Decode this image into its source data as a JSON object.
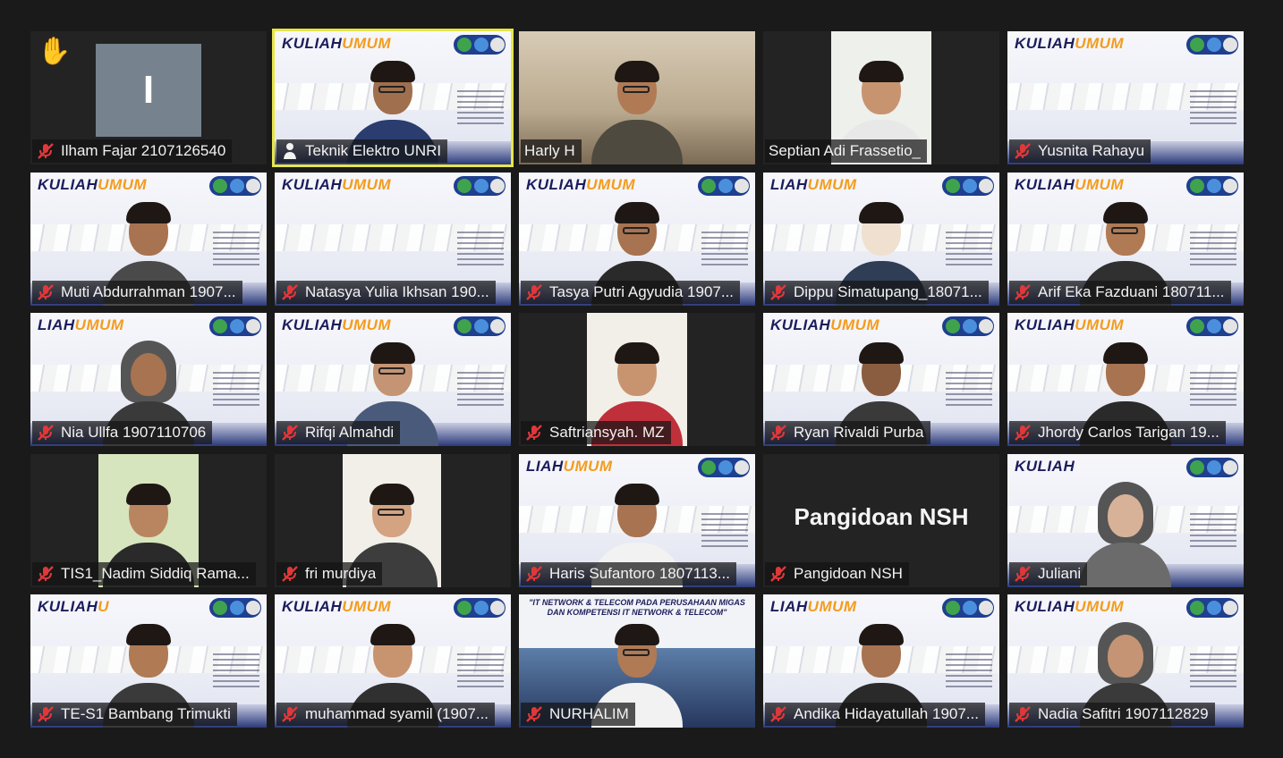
{
  "meeting": {
    "participants": [
      {
        "name": "Ilham Fajar 2107126540",
        "muted": true,
        "view": "initial",
        "initial": "I",
        "raised_hand": true
      },
      {
        "name": "Teknik Elektro UNRI",
        "muted": false,
        "view": "slide",
        "active_speaker": true,
        "slide_title": "KULIAH UMUM",
        "slide_title_accent": "UMUM",
        "slide_title_main": "KULIAH"
      },
      {
        "name": "Harly H",
        "muted": false,
        "view": "camera"
      },
      {
        "name": "Septian Adi Frassetio_",
        "muted": false,
        "view": "camera"
      },
      {
        "name": "Yusnita Rahayu",
        "muted": true,
        "view": "slide",
        "slide_title_main": "KULIAH",
        "slide_title_accent": "UMUM"
      },
      {
        "name": "Muti Abdurrahman 1907...",
        "muted": true,
        "view": "slide",
        "slide_title_main": "KULIAH",
        "slide_title_accent": "UMUM"
      },
      {
        "name": "Natasya Yulia Ikhsan 190...",
        "muted": true,
        "view": "slide",
        "slide_title_main": "KULIAH",
        "slide_title_accent": "UMUM"
      },
      {
        "name": "Tasya Putri Agyudia 1907...",
        "muted": true,
        "view": "slide",
        "slide_title_main": "KULIAH",
        "slide_title_accent": "UMUM"
      },
      {
        "name": "Dippu Simatupang_18071...",
        "muted": true,
        "view": "slide",
        "slide_title_main": "LIAH",
        "slide_title_accent": "UMUM"
      },
      {
        "name": "Arif Eka Fazduani 180711...",
        "muted": true,
        "view": "slide",
        "slide_title_main": "KULIAH",
        "slide_title_accent": "UMUM"
      },
      {
        "name": "Nia Ullfa 1907110706",
        "muted": true,
        "view": "slide",
        "slide_title_main": "LIAH",
        "slide_title_accent": "UMUM"
      },
      {
        "name": "Rifqi Almahdi",
        "muted": true,
        "view": "slide",
        "slide_title_main": "KULIAH",
        "slide_title_accent": "UMUM"
      },
      {
        "name": "Saftriansyah. MZ",
        "muted": true,
        "view": "camera"
      },
      {
        "name": "Ryan Rivaldi Purba",
        "muted": true,
        "view": "slide",
        "slide_title_main": "KULIAH",
        "slide_title_accent": "UMUM"
      },
      {
        "name": "Jhordy Carlos Tarigan 19...",
        "muted": true,
        "view": "slide",
        "slide_title_main": "KULIAH",
        "slide_title_accent": "UMUM"
      },
      {
        "name": "TIS1_Nadim Siddiq Rama...",
        "muted": true,
        "view": "camera"
      },
      {
        "name": "fri murdiya",
        "muted": true,
        "view": "camera"
      },
      {
        "name": "Haris Sufantoro 1807113...",
        "muted": true,
        "view": "slide",
        "slide_title_main": "LIAH",
        "slide_title_accent": "UMUM"
      },
      {
        "name": "Pangidoan NSH",
        "muted": true,
        "view": "name",
        "display_name": "Pangidoan NSH"
      },
      {
        "name": "Juliani",
        "muted": true,
        "view": "slide",
        "slide_title_main": "KULIAH",
        "slide_title_accent": ""
      },
      {
        "name": "TE-S1 Bambang Trimukti",
        "muted": true,
        "view": "slide",
        "slide_title_main": "KULIAH",
        "slide_title_accent": "U"
      },
      {
        "name": "muhammad syamil (1907...",
        "muted": true,
        "view": "slide",
        "slide_title_main": "KULIAH",
        "slide_title_accent": "UMUM"
      },
      {
        "name": "NURHALIM",
        "muted": true,
        "view": "banner",
        "banner_text": "\"IT NETWORK & TELECOM PADA PERUSAHAAN MIGAS DAN KOMPETENSI IT NETWORK & TELECOM\""
      },
      {
        "name": "Andika Hidayatullah 1907...",
        "muted": true,
        "view": "slide",
        "slide_title_main": "LIAH",
        "slide_title_accent": "UMUM"
      },
      {
        "name": "Nadia Safitri 1907112829",
        "muted": true,
        "view": "slide",
        "slide_title_main": "KULIAH",
        "slide_title_accent": "UMUM"
      }
    ]
  },
  "colors": {
    "background": "#1a1a1a",
    "tile": "#232323",
    "active_border": "#e6e64a",
    "muted_icon": "#e0383a",
    "slide_navy": "#1b1d5c",
    "slide_orange": "#f39c1e"
  },
  "icons": {
    "muted": "mic-off-icon",
    "speaker": "speaker-icon",
    "hand": "raised-hand-icon"
  }
}
